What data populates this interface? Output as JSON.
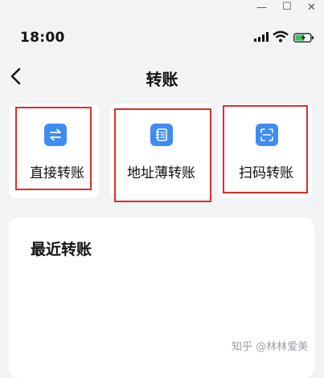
{
  "status_bar": {
    "time": "18:00"
  },
  "nav": {
    "title": "转账"
  },
  "actions": [
    {
      "label": "直接转账",
      "icon": "transfer-arrows-icon"
    },
    {
      "label": "地址薄转账",
      "icon": "address-book-icon"
    },
    {
      "label": "扫码转账",
      "icon": "scan-code-icon"
    }
  ],
  "recent": {
    "title": "最近转账"
  },
  "watermark": "知乎 @林林爱美",
  "colors": {
    "accent": "#3f8cf3",
    "highlight": "#e02c2c",
    "background": "#f2f3f5"
  }
}
